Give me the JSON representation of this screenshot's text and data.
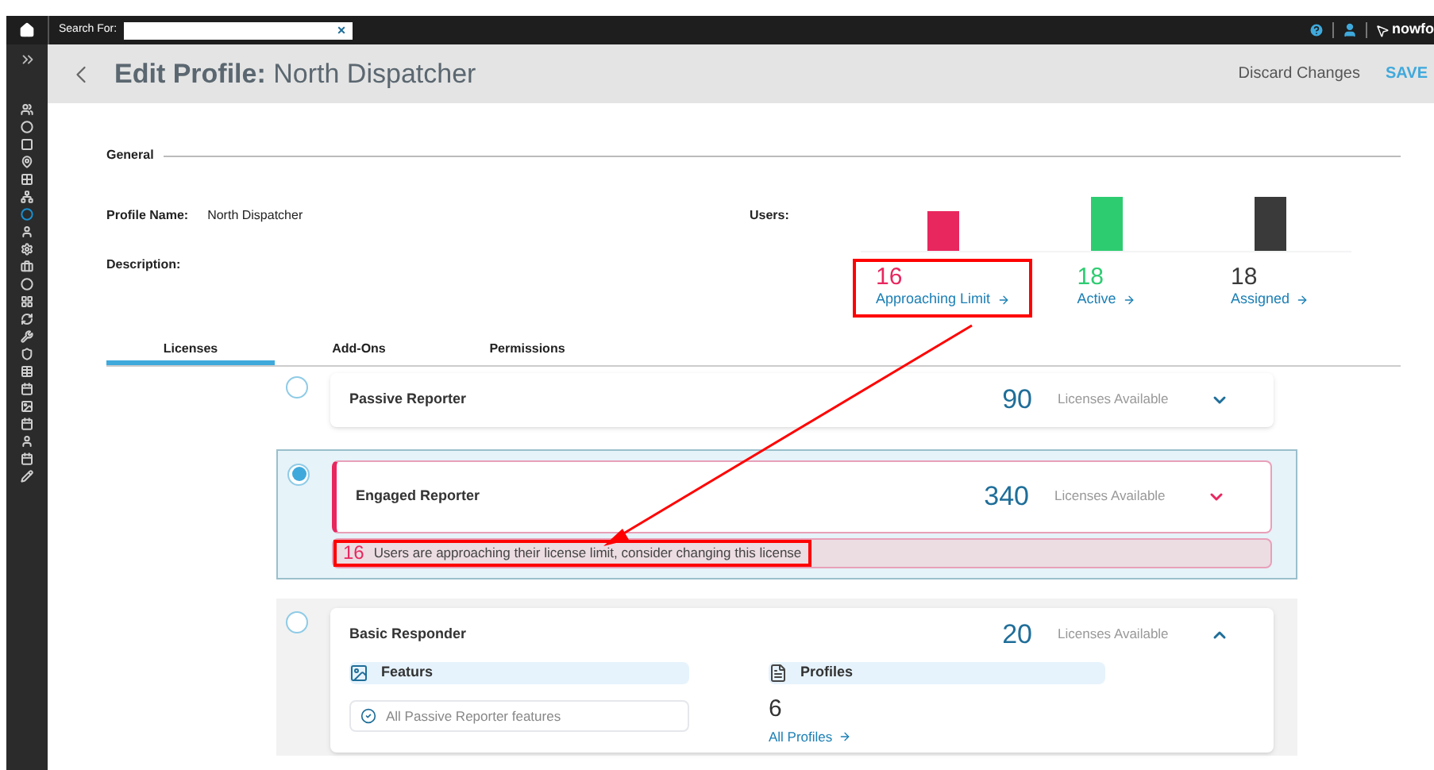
{
  "topbar": {
    "search_label": "Search For:",
    "clear": "×",
    "logo": "nowfo"
  },
  "sidebar": {
    "items": [
      {
        "selected": false
      },
      {
        "selected": false
      },
      {
        "selected": false
      },
      {
        "selected": false
      },
      {
        "selected": false
      },
      {
        "selected": false
      },
      {
        "selected": true
      },
      {
        "selected": false
      },
      {
        "selected": false
      },
      {
        "selected": false
      },
      {
        "selected": false
      },
      {
        "selected": false
      },
      {
        "selected": false
      },
      {
        "selected": false
      },
      {
        "selected": false
      },
      {
        "selected": false
      },
      {
        "selected": false
      },
      {
        "selected": false
      },
      {
        "selected": false
      },
      {
        "selected": false
      },
      {
        "selected": false
      },
      {
        "selected": false
      }
    ]
  },
  "header": {
    "title_bold": "Edit Profile:",
    "title": "North Dispatcher",
    "discard": "Discard Changes",
    "save": "SAVE"
  },
  "general": {
    "heading": "General",
    "profile_name_label": "Profile Name:",
    "profile_name": "North Dispatcher",
    "description_label": "Description:",
    "users_label": "Users:"
  },
  "users": [
    {
      "count": "16",
      "label": "Approaching Limit",
      "color": "#e8275f",
      "highlighted": true
    },
    {
      "count": "18",
      "label": "Active",
      "color": "#2ecc71",
      "highlighted": false
    },
    {
      "count": "18",
      "label": "Assigned",
      "color": "#3a3a3a",
      "highlighted": false
    }
  ],
  "tabs": [
    {
      "label": "Licenses",
      "selected": true
    },
    {
      "label": "Add-Ons",
      "selected": false
    },
    {
      "label": "Permissions",
      "selected": false
    }
  ],
  "licenses": [
    {
      "name": "Passive Reporter",
      "count": "90",
      "available": "Licenses Available",
      "selected": false,
      "expanded": false
    },
    {
      "name": "Engaged Reporter",
      "count": "340",
      "available": "Licenses Available",
      "selected": true,
      "expanded": false,
      "warning": {
        "count": "16",
        "text": "Users are approaching their license limit, consider changing this license"
      }
    },
    {
      "name": "Basic Responder",
      "count": "20",
      "available": "Licenses Available",
      "selected": false,
      "expanded": true,
      "features": {
        "heading": "Featurs",
        "items": [
          "All Passive Reporter features"
        ]
      },
      "profiles": {
        "heading": "Profiles",
        "count": "6",
        "link": "All Profiles"
      }
    }
  ]
}
